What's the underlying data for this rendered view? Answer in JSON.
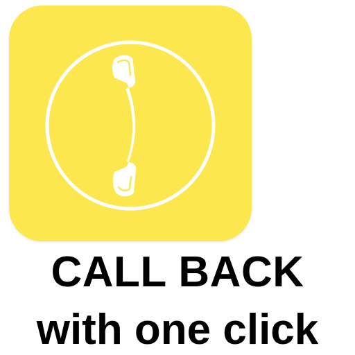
{
  "app": {
    "icon": "phone-handset-icon",
    "icon_background_color": "#fde74e",
    "icon_foreground_color": "#ffffff"
  },
  "caption": {
    "line1": "CALL BACK",
    "line2": "with one click",
    "color": "#000000"
  }
}
